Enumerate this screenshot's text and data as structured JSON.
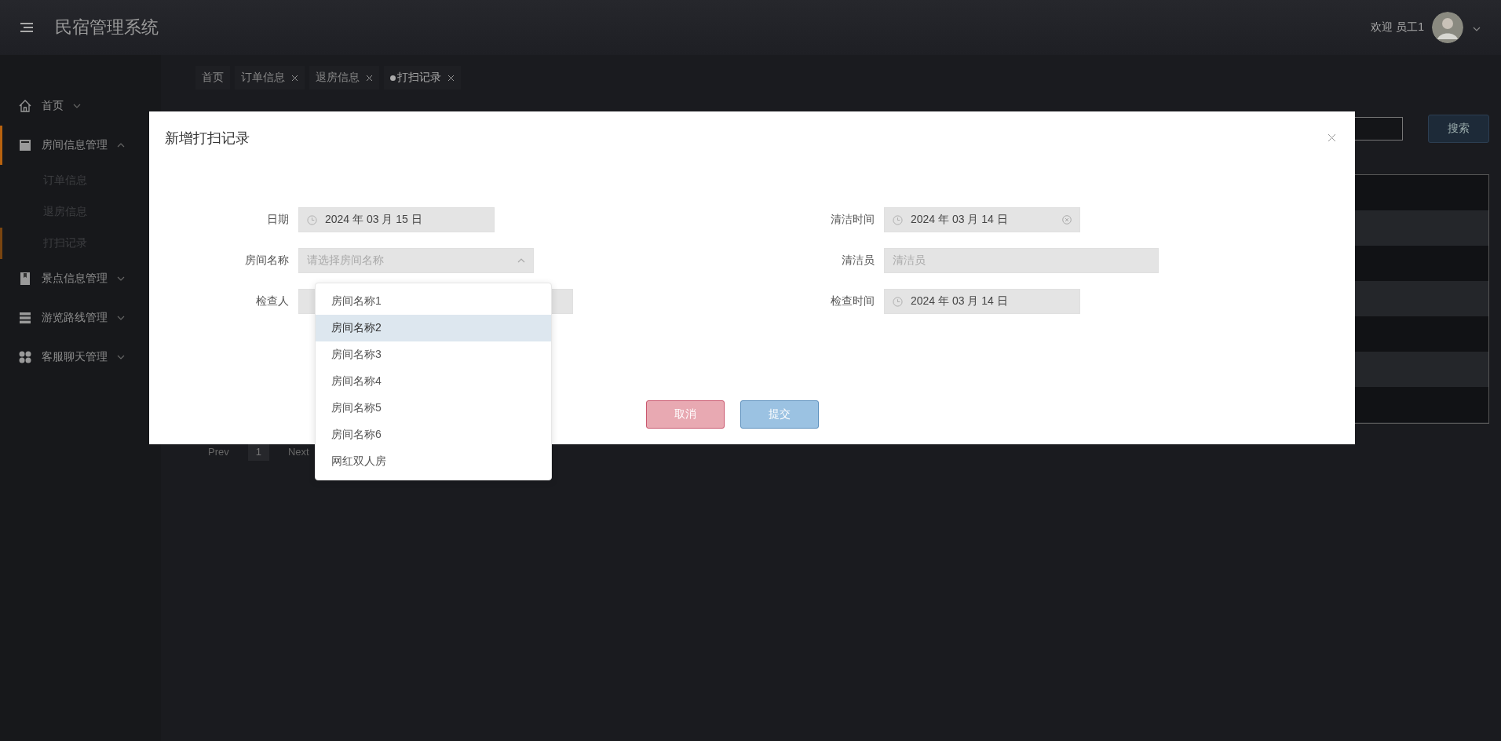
{
  "header": {
    "title": "民宿管理系统",
    "welcome": "欢迎 员工1"
  },
  "sidebar": {
    "items": [
      {
        "label": "首页",
        "kind": "home",
        "expanded": false,
        "selected": false
      },
      {
        "label": "房间信息管理",
        "kind": "store",
        "expanded": true,
        "selected": true,
        "children": [
          {
            "label": "订单信息",
            "selected": false
          },
          {
            "label": "退房信息",
            "selected": false
          },
          {
            "label": "打扫记录",
            "selected": true
          }
        ]
      },
      {
        "label": "景点信息管理",
        "kind": "bookmark",
        "expanded": false,
        "selected": false
      },
      {
        "label": "游览路线管理",
        "kind": "list",
        "expanded": false,
        "selected": false
      },
      {
        "label": "客服聊天管理",
        "kind": "grid",
        "expanded": false,
        "selected": false
      }
    ]
  },
  "tabs": [
    {
      "label": "首页",
      "closable": false,
      "selected": false
    },
    {
      "label": "订单信息",
      "closable": true,
      "selected": false
    },
    {
      "label": "退房信息",
      "closable": true,
      "selected": false
    },
    {
      "label": "打扫记录",
      "closable": true,
      "selected": true
    }
  ],
  "toolbar": {
    "search_button": "搜索"
  },
  "pagination": {
    "prev": "Prev",
    "page": "1",
    "next": "Next"
  },
  "dialog": {
    "title": "新增打扫记录",
    "rows": [
      [
        {
          "label": "日期",
          "kind": "date",
          "value": "2024 年 03 月 15 日",
          "clearable": false
        },
        {
          "label": "清洁时间",
          "kind": "date",
          "value": "2024 年 03 月 14 日",
          "clearable": true
        }
      ],
      [
        {
          "label": "房间名称",
          "kind": "select",
          "placeholder": "请选择房间名称",
          "expanded": true
        },
        {
          "label": "清洁员",
          "kind": "text",
          "placeholder": "清洁员"
        }
      ],
      [
        {
          "label": "检查人",
          "kind": "text"
        },
        {
          "label": "检查时间",
          "kind": "date",
          "value": "2024 年 03 月 14 日",
          "clearable": false
        }
      ]
    ],
    "dropdown": [
      {
        "label": "房间名称1",
        "highlighted": false
      },
      {
        "label": "房间名称2",
        "highlighted": true
      },
      {
        "label": "房间名称3",
        "highlighted": false
      },
      {
        "label": "房间名称4",
        "highlighted": false
      },
      {
        "label": "房间名称5",
        "highlighted": false
      },
      {
        "label": "房间名称6",
        "highlighted": false
      },
      {
        "label": "网红双人房",
        "highlighted": false
      }
    ],
    "buttons": [
      {
        "label": "取消",
        "kind": "cancel"
      },
      {
        "label": "提交",
        "kind": "submit"
      }
    ]
  }
}
